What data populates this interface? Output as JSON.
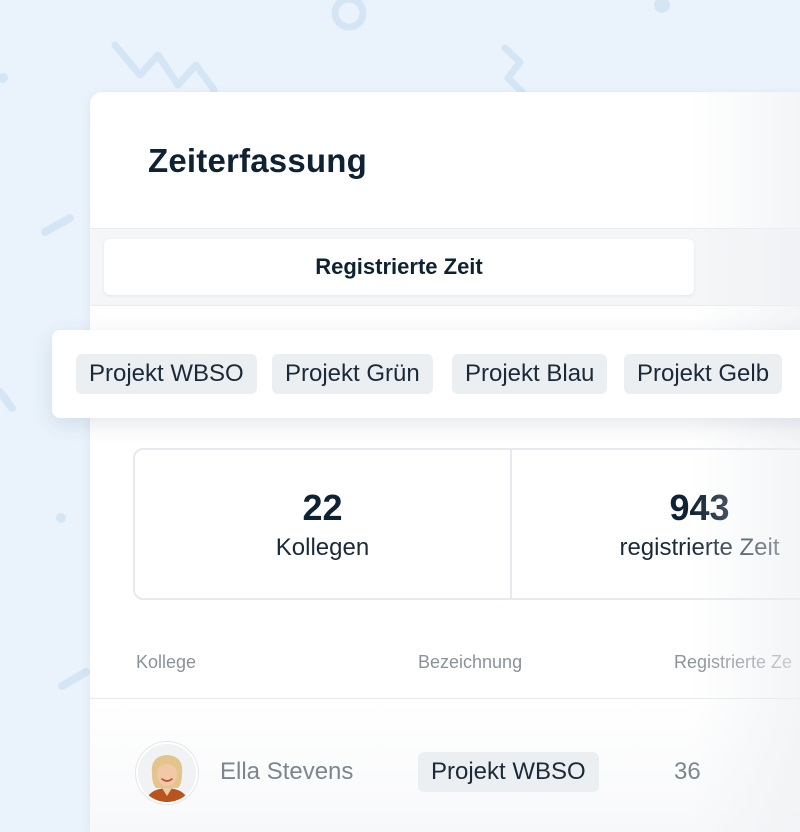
{
  "page": {
    "title": "Zeiterfassung"
  },
  "tabs": {
    "active_label": "Registrierte Zeit"
  },
  "project_chips": [
    {
      "label": "Projekt WBSO"
    },
    {
      "label": "Projekt Grün"
    },
    {
      "label": "Projekt Blau"
    },
    {
      "label": "Projekt Gelb"
    }
  ],
  "stats": [
    {
      "value": "22",
      "label": "Kollegen"
    },
    {
      "value": "943",
      "label": "registrierte Zeit"
    }
  ],
  "table": {
    "headers": {
      "colleague": "Kollege",
      "designation": "Bezeichnung",
      "registered_time": "Registrierte Ze"
    },
    "rows": [
      {
        "name": "Ella Stevens",
        "project": "Projekt WBSO",
        "hours": "36"
      }
    ]
  },
  "colors": {
    "background": "#eaf3fb",
    "decoration": "#d4e6f5",
    "text_primary": "#0f2233",
    "text_muted": "#8a929a",
    "chip_bg": "#eceff2"
  }
}
